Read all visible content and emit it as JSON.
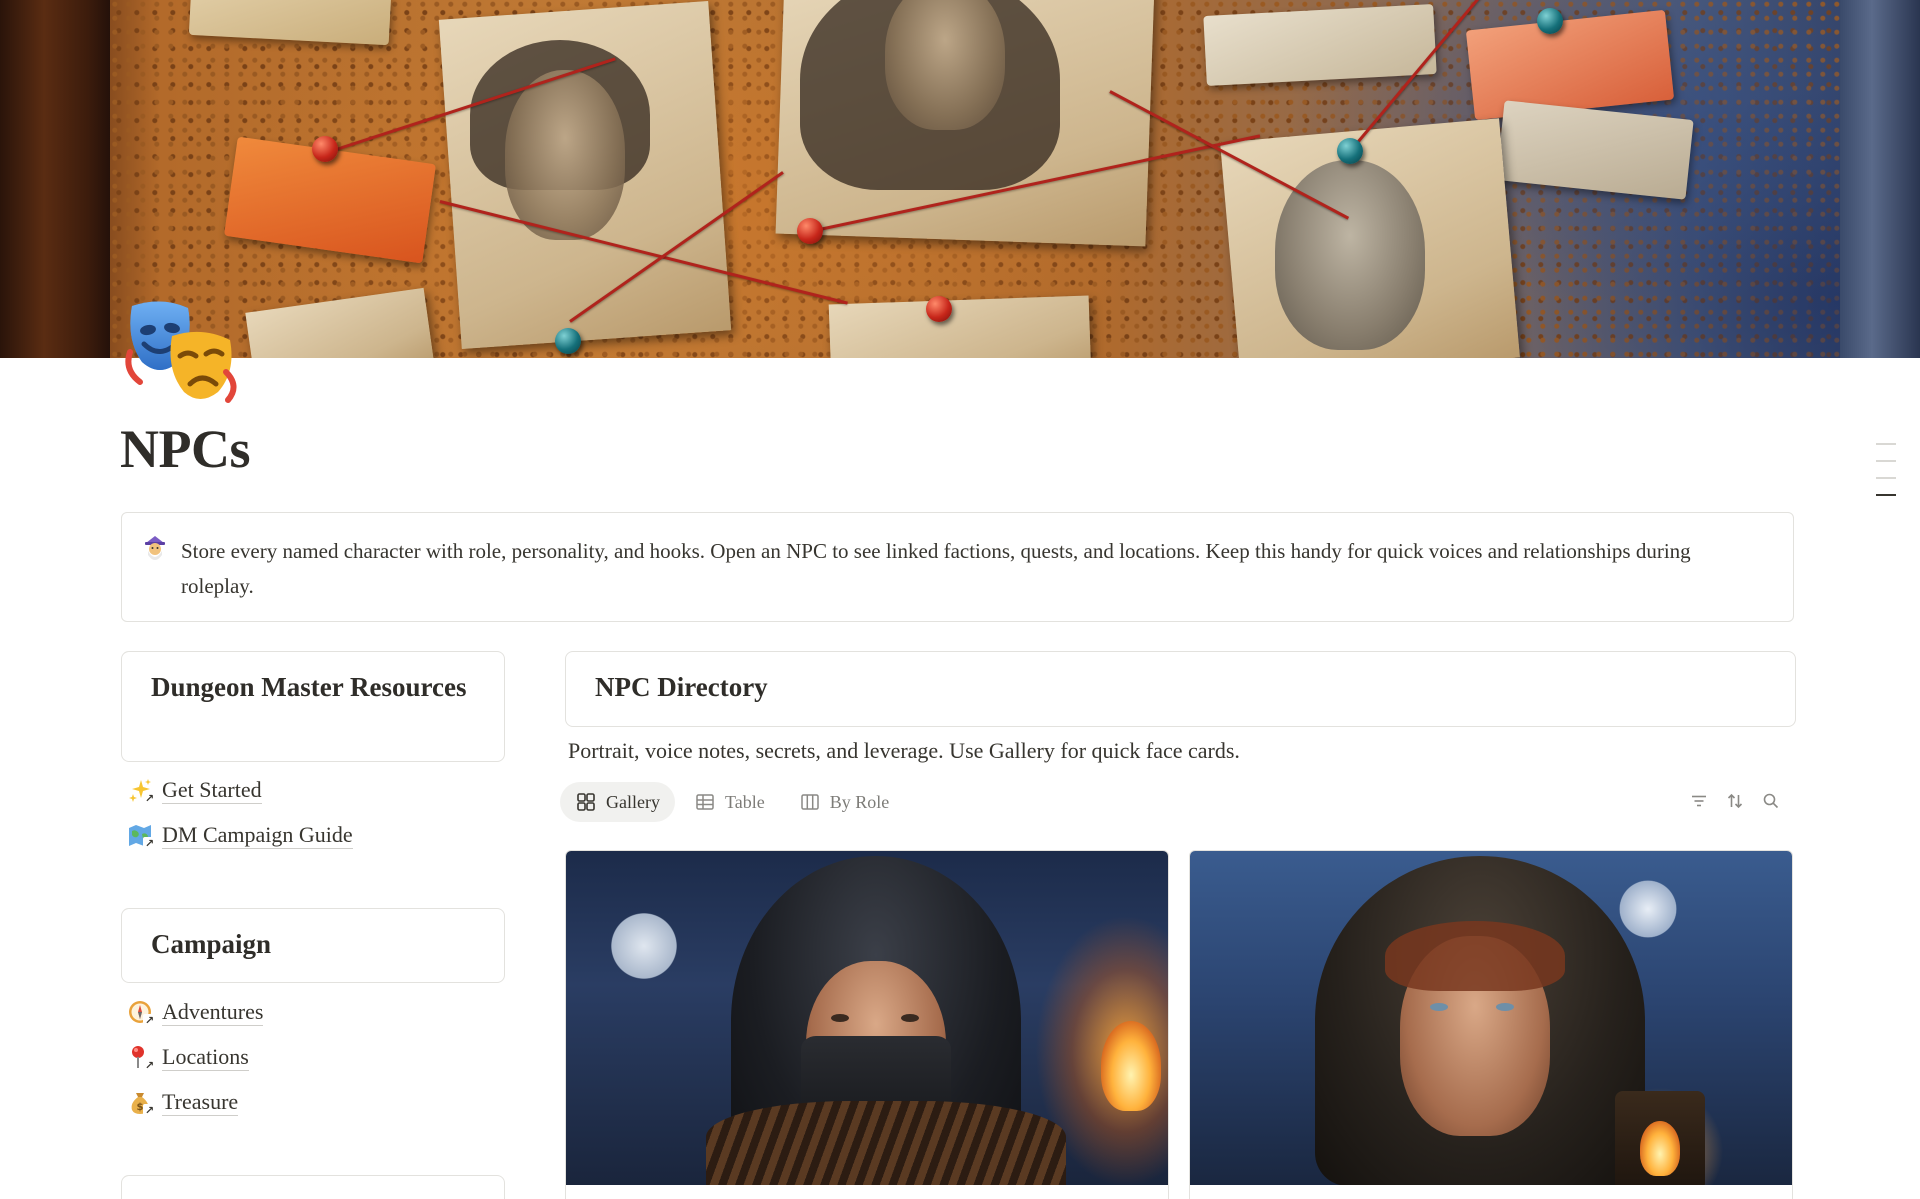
{
  "page": {
    "title": "NPCs",
    "icon": "performing-arts-masks-icon"
  },
  "callout": {
    "icon": "mage-icon",
    "text": "Store every named character with role, personality, and hooks. Open an NPC to see linked factions, quests, and locations. Keep this handy for quick voices and relationships during roleplay."
  },
  "sidebar": {
    "sections": [
      {
        "title": "Dungeon Master Resources",
        "links": [
          {
            "icon": "sparkles-icon",
            "label": "Get Started"
          },
          {
            "icon": "world-map-icon",
            "label": "DM Campaign Guide"
          }
        ]
      },
      {
        "title": "Campaign",
        "links": [
          {
            "icon": "compass-icon",
            "label": "Adventures"
          },
          {
            "icon": "round-pushpin-icon",
            "label": "Locations"
          },
          {
            "icon": "money-bag-icon",
            "label": "Treasure"
          }
        ]
      }
    ]
  },
  "directory": {
    "title": "NPC Directory",
    "description": "Portrait, voice notes, secrets, and leverage. Use Gallery for quick face cards.",
    "views": [
      {
        "label": "Gallery",
        "icon": "gallery-icon",
        "active": true
      },
      {
        "label": "Table",
        "icon": "table-icon",
        "active": false
      },
      {
        "label": "By Role",
        "icon": "board-icon",
        "active": false
      }
    ],
    "tools": [
      "filter-icon",
      "sort-icon",
      "search-icon"
    ],
    "cards": [
      {
        "image": "hooded-masked-rogue-portrait"
      },
      {
        "image": "hooded-woman-with-lantern-portrait"
      }
    ]
  },
  "colors": {
    "text": "#37352f",
    "muted": "#7d7c78",
    "border": "#e3e2de",
    "active_tab_bg": "#f1f1ef"
  }
}
